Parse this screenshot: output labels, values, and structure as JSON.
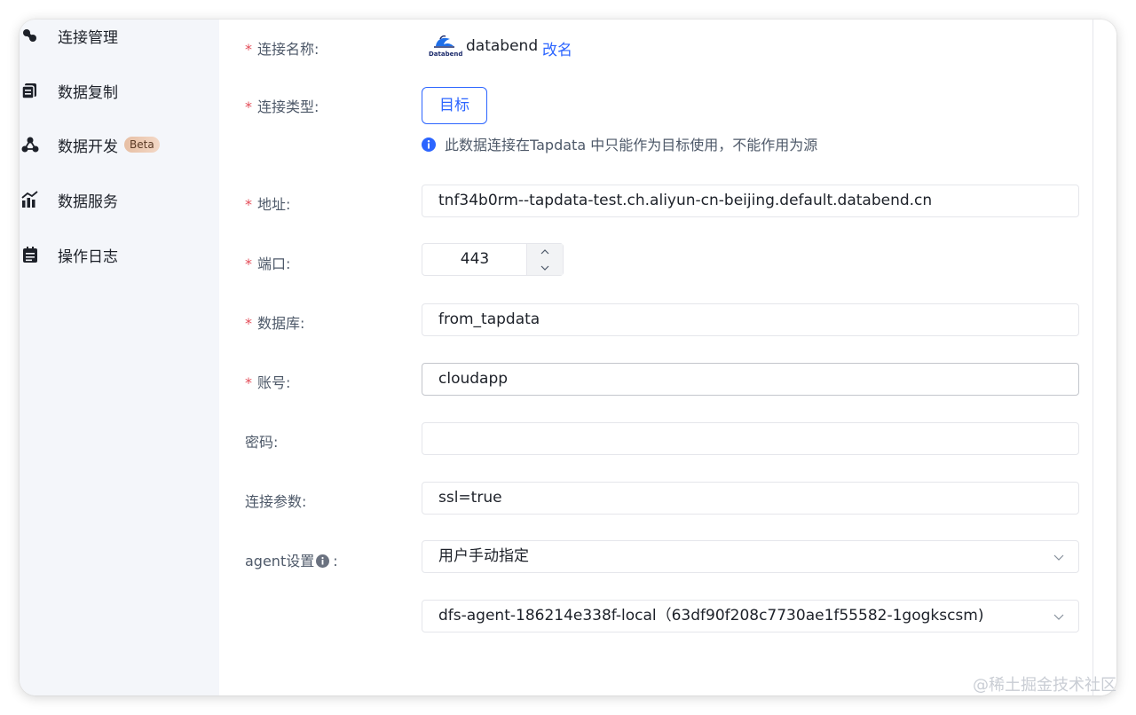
{
  "sidebar": {
    "items": [
      {
        "label": "连接管理",
        "icon": "connection-icon"
      },
      {
        "label": "数据复制",
        "icon": "copy-icon"
      },
      {
        "label": "数据开发",
        "icon": "graph-icon",
        "badge": "Beta"
      },
      {
        "label": "数据服务",
        "icon": "chart-icon"
      },
      {
        "label": "操作日志",
        "icon": "log-icon"
      }
    ]
  },
  "form": {
    "name": {
      "label": "连接名称:",
      "logo_text": "Databend",
      "value": "databend",
      "rename": "改名"
    },
    "type": {
      "label": "连接类型:",
      "button": "目标",
      "hint": "此数据连接在Tapdata 中只能作为目标使用，不能作用为源"
    },
    "address": {
      "label": "地址:",
      "value": "tnf34b0rm--tapdata-test.ch.aliyun-cn-beijing.default.databend.cn"
    },
    "port": {
      "label": "端口:",
      "value": "443"
    },
    "database": {
      "label": "数据库:",
      "value": "from_tapdata"
    },
    "account": {
      "label": "账号:",
      "value": "cloudapp"
    },
    "password": {
      "label": "密码:",
      "value": ""
    },
    "params": {
      "label": "连接参数:",
      "value": "ssl=true"
    },
    "agent": {
      "label": "agent设置",
      "colon": ":",
      "mode": "用户手动指定",
      "selected_agent": "dfs-agent-186214e338f-local（63df90f208c7730ae1f55582-1gogkscsm)"
    }
  },
  "required_mark": "*",
  "watermark": "@稀土掘金技术社区",
  "colors": {
    "accent": "#2c65ff",
    "required": "#e34d59",
    "sidebar_bg": "#f4f6fa"
  }
}
